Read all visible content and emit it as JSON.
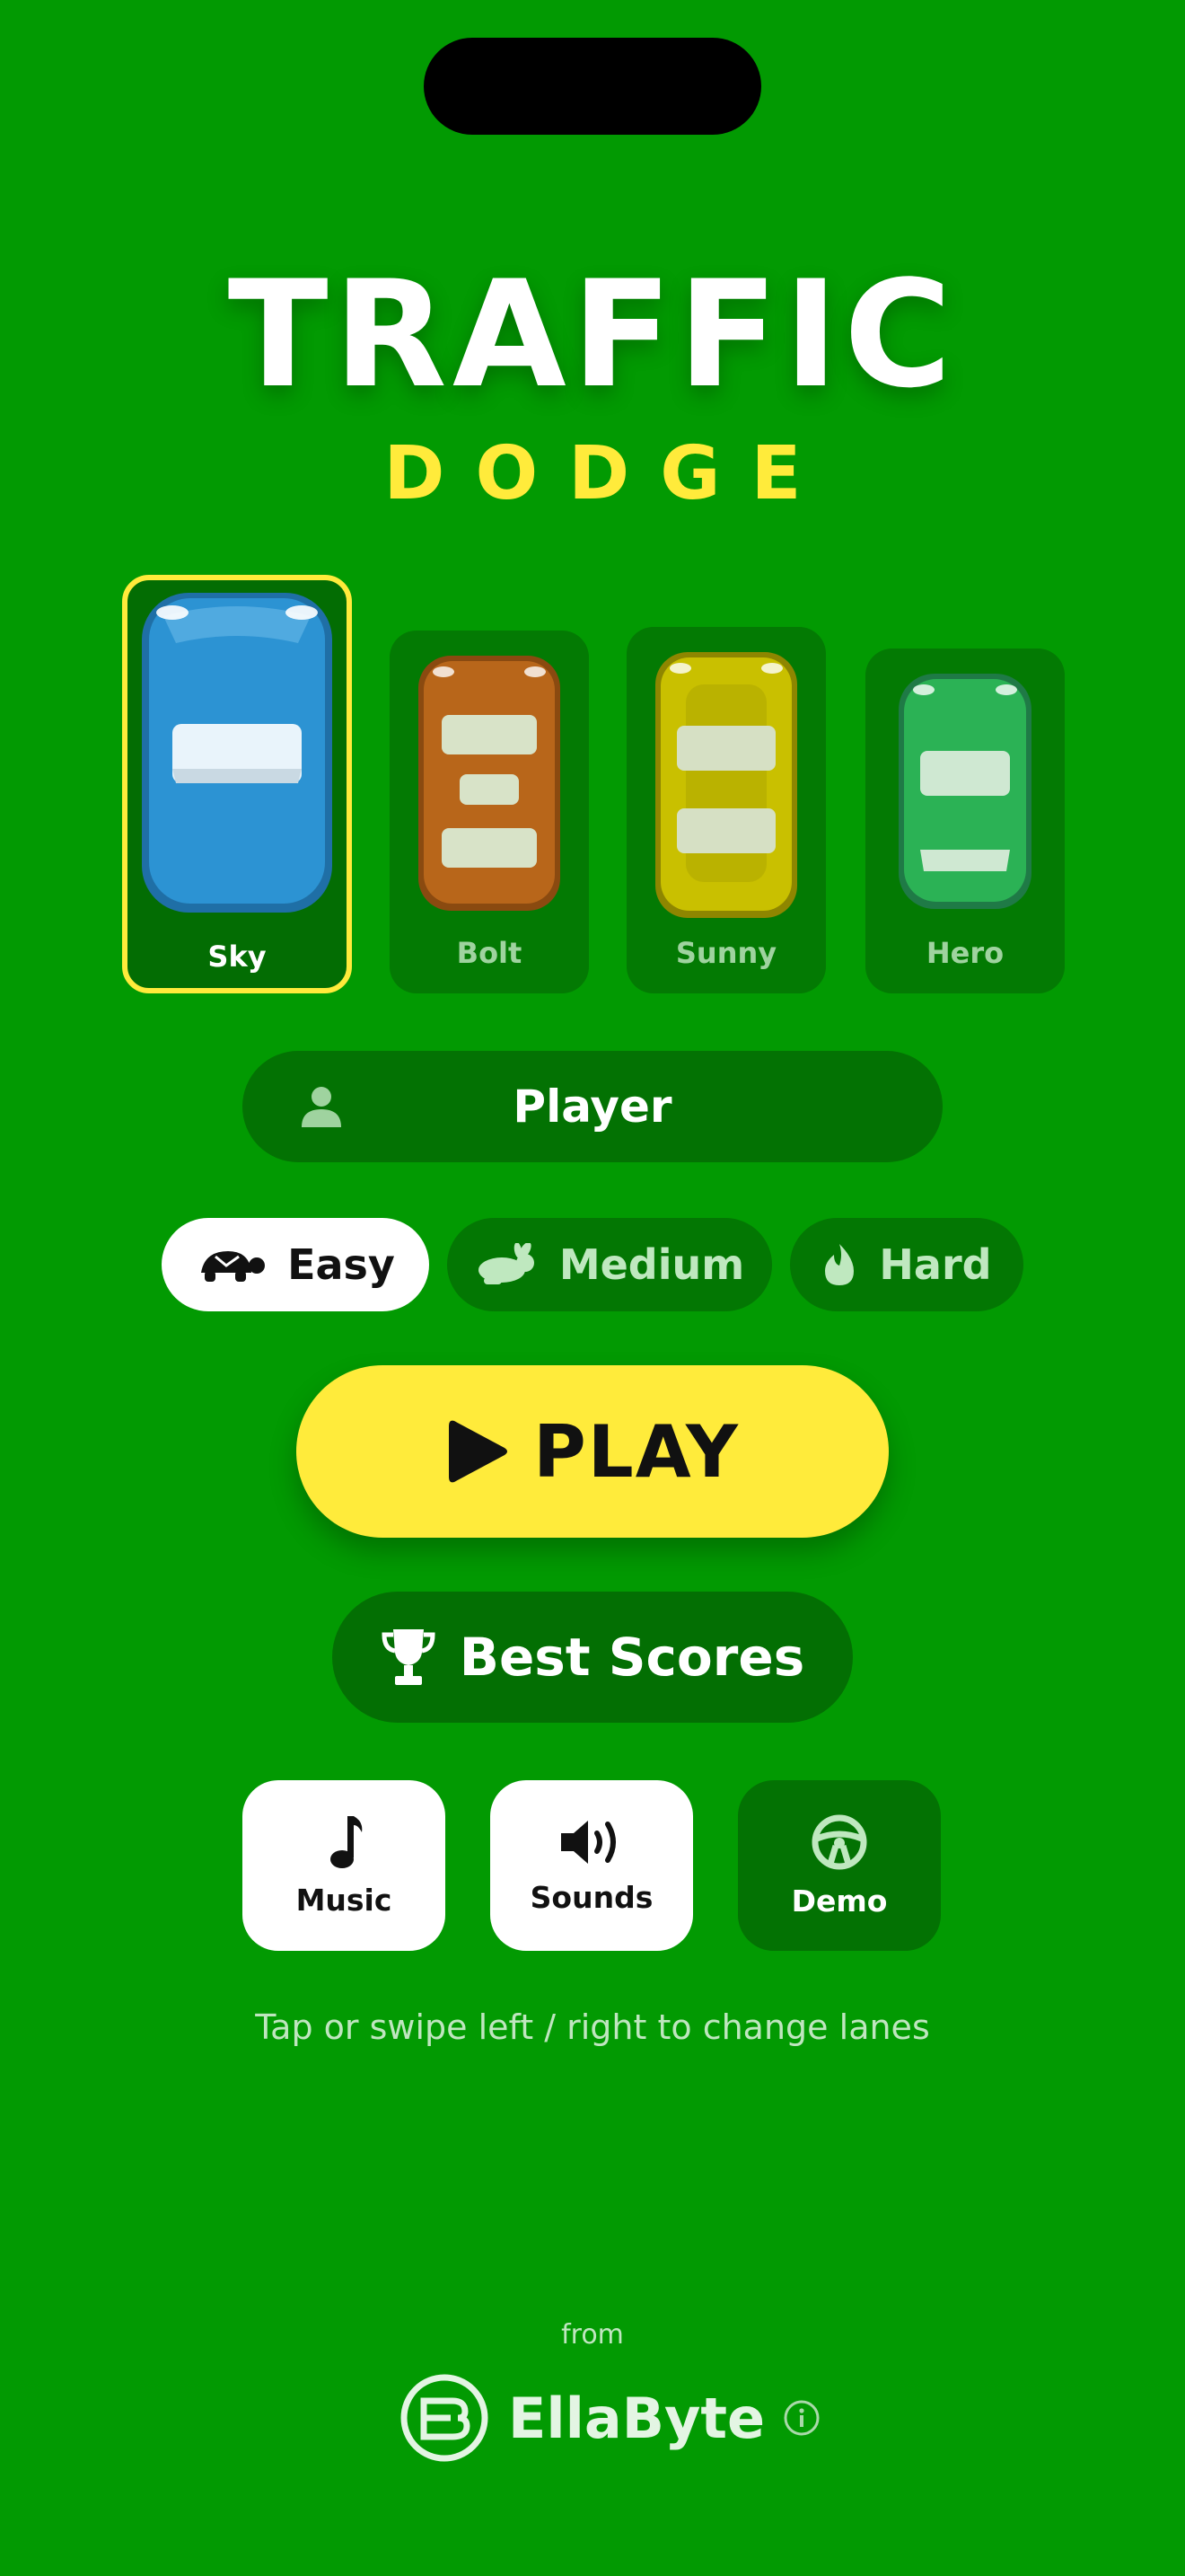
{
  "app": {
    "title": "TRAFFIC",
    "subtitle": "DODGE"
  },
  "cars": [
    {
      "label": "Sky",
      "color": "#2c93d3",
      "selected": true
    },
    {
      "label": "Bolt",
      "color": "#b8661a",
      "selected": false
    },
    {
      "label": "Sunny",
      "color": "#c9c000",
      "selected": false
    },
    {
      "label": "Hero",
      "color": "#2bb255",
      "selected": false
    }
  ],
  "player": {
    "name": "Player",
    "icon": "person-icon"
  },
  "difficulty": {
    "options": [
      {
        "label": "Easy",
        "icon": "turtle-icon",
        "active": true
      },
      {
        "label": "Medium",
        "icon": "rabbit-icon",
        "active": false
      },
      {
        "label": "Hard",
        "icon": "flame-icon",
        "active": false
      }
    ]
  },
  "play": {
    "label": "PLAY",
    "icon": "play-icon"
  },
  "best_scores": {
    "label": "Best Scores",
    "icon": "trophy-icon"
  },
  "toggles": [
    {
      "label": "Music",
      "icon": "music-note-icon",
      "on": true
    },
    {
      "label": "Sounds",
      "icon": "speaker-icon",
      "on": true
    },
    {
      "label": "Demo",
      "icon": "steering-wheel-icon",
      "on": false
    }
  ],
  "hint": "Tap or swipe left / right to change lanes",
  "footer": {
    "from": "from",
    "brand": "EllaByte",
    "info_icon": "info-icon"
  },
  "colors": {
    "background": "#029a02",
    "accent": "#ffeb3b",
    "panel": "#037203"
  }
}
